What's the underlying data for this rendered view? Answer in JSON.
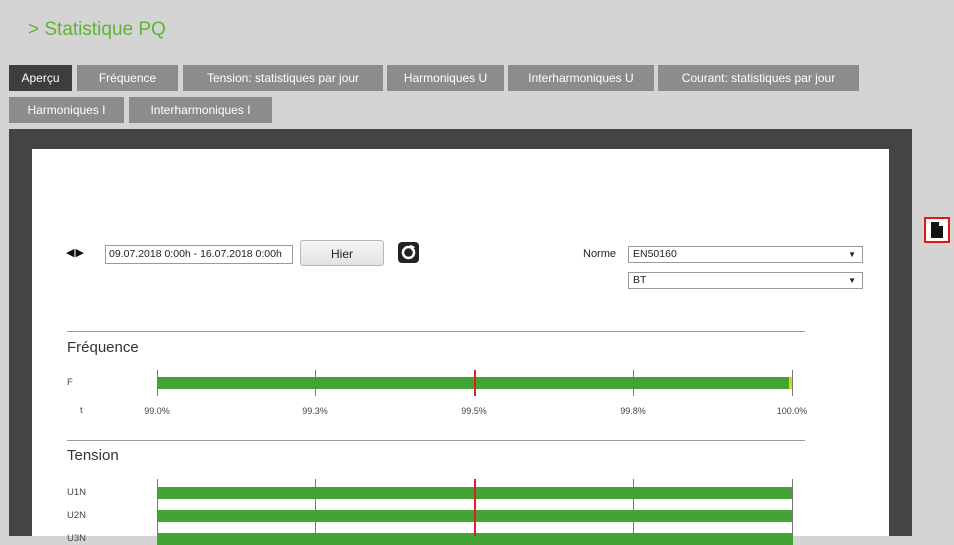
{
  "page": {
    "title": "> Statistique PQ"
  },
  "tabs": [
    {
      "label": "Aperçu",
      "active": true
    },
    {
      "label": "Fréquence"
    },
    {
      "label": "Tension: statistiques par jour"
    },
    {
      "label": "Harmoniques U"
    },
    {
      "label": "Interharmoniques U"
    },
    {
      "label": "Courant: statistiques par jour"
    },
    {
      "label": "Harmoniques I"
    },
    {
      "label": "Interharmoniques I"
    }
  ],
  "controls": {
    "date_range": "09.07.2018 0:00h - 16.07.2018 0:00h",
    "hier_label": "Hier",
    "norme_label": "Norme",
    "norme_value": "EN50160",
    "network_value": "BT"
  },
  "frequence": {
    "heading": "Fréquence",
    "row_label": "F",
    "axis_label_t": "t",
    "axis_ticks": [
      "99.0%",
      "99.3%",
      "99.5%",
      "99.8%",
      "100.0%"
    ],
    "value_percent": 100.0
  },
  "tension": {
    "heading": "Tension",
    "rows": [
      "U1N",
      "U2N",
      "U3N"
    ]
  },
  "colors": {
    "accent": "#5fb336",
    "bar": "#44a335",
    "limit": "#e02020",
    "edge": "#e8d400"
  }
}
